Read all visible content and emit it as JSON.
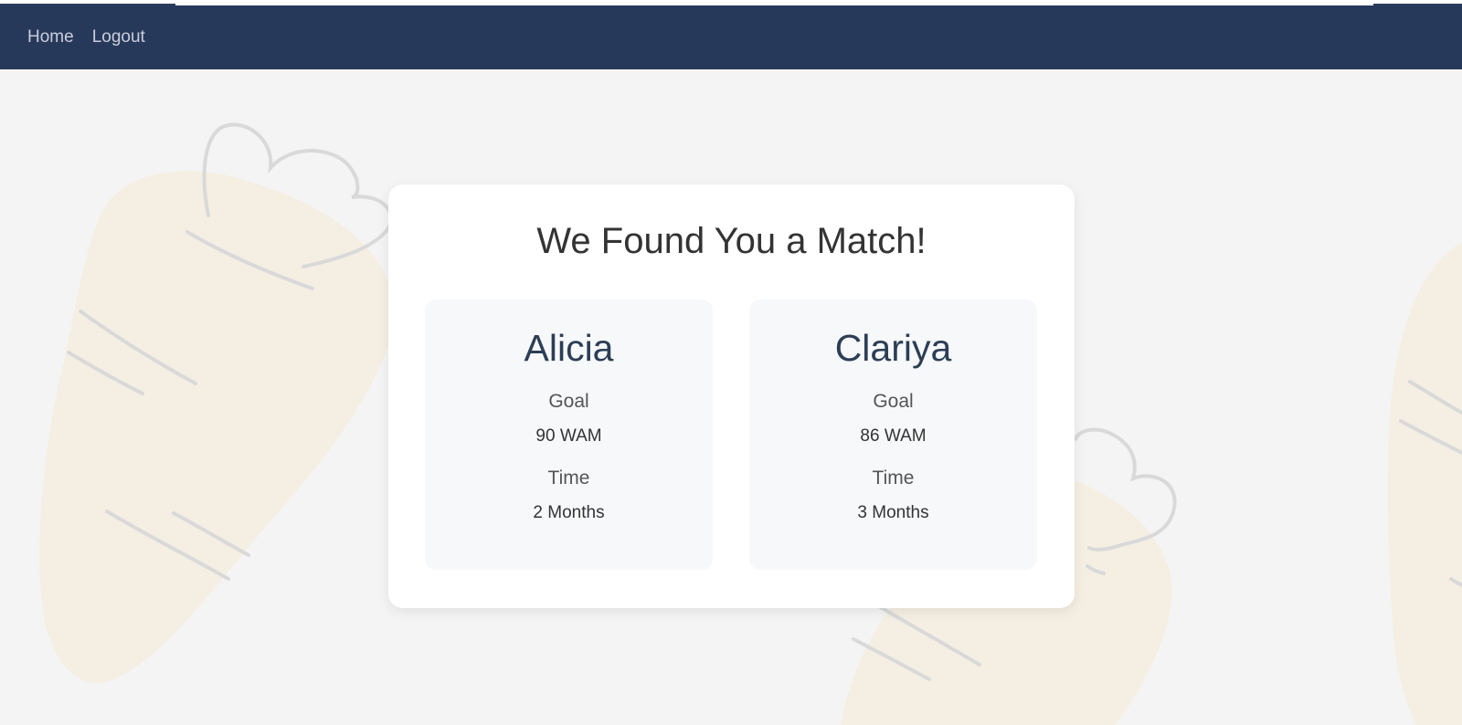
{
  "nav": {
    "links": [
      "Home",
      "Logout"
    ],
    "background": "#27395b"
  },
  "match": {
    "title": "We Found You a Match!",
    "people": [
      {
        "name": "Alicia",
        "goal_label": "Goal",
        "goal_value": "90 WAM",
        "time_label": "Time",
        "time_value": "2 Months"
      },
      {
        "name": "Clariya",
        "goal_label": "Goal",
        "goal_value": "86 WAM",
        "time_label": "Time",
        "time_value": "3 Months"
      }
    ]
  },
  "background": {
    "illustration": "carrot-illustrations"
  }
}
